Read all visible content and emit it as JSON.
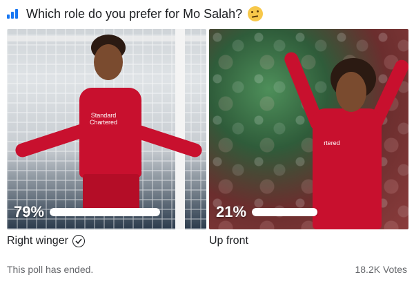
{
  "poll": {
    "question": "Which role do you prefer for Mo Salah?",
    "header_icon": "poll-bar-chart-icon",
    "emoji": "thinking-face-emoji",
    "options": [
      {
        "label": "Right winger",
        "percent_text": "79%",
        "percent": 79,
        "selected": true,
        "sponsor_line1": "Standard",
        "sponsor_line2": "Chartered"
      },
      {
        "label": "Up front",
        "percent_text": "21%",
        "percent": 21,
        "selected": false,
        "sponsor_line1": "",
        "sponsor_line2": "rtered"
      }
    ],
    "status": "This poll has ended.",
    "votes": "18.2K Votes"
  },
  "colors": {
    "accent": "#1877f2",
    "kit_red": "#c8102e",
    "text": "#1c1e21",
    "muted": "#65676b"
  }
}
